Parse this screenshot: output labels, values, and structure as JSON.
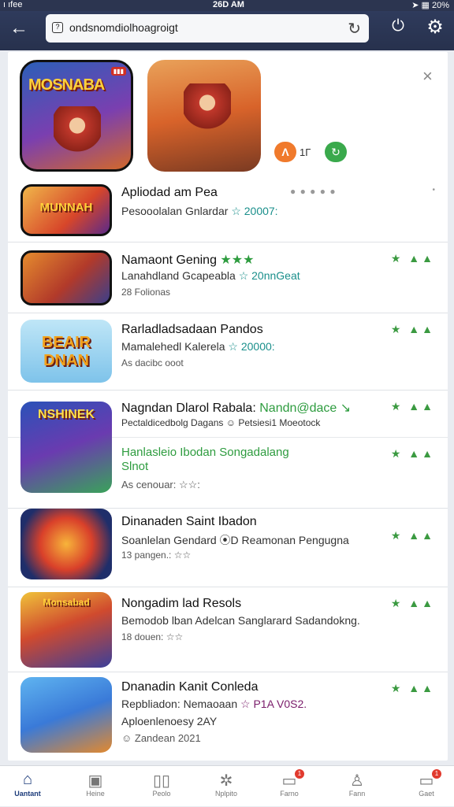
{
  "status": {
    "left": "ı ıfee",
    "time": "26D AM",
    "right": "➤ ▦ 20%"
  },
  "browser": {
    "url": "ondsnomdiolhoagroigt",
    "back_icon": "arrow-left-icon",
    "reload_icon": "reload-icon",
    "power_icon": "power-icon",
    "settings_icon": "gear-icon"
  },
  "featured": {
    "items": [
      {
        "title": "MOSNABA",
        "tag": "▮▮▮"
      },
      {
        "title": ""
      }
    ],
    "mini_badge_1": "Λ",
    "mini_text": "1Г",
    "mini_badge_2": "↻",
    "close": "×"
  },
  "apps": [
    {
      "name": "Apliodad am Pea",
      "sub": "Pesooolalan Gnlardar",
      "sub_hl": "☆ 20007:",
      "meta": "",
      "icon_label": "MUNNAH",
      "dots": "● ● ● ● ●",
      "end": "•"
    },
    {
      "name": "Namaont Gening",
      "name_extra": "★★★",
      "sub": "Lanahdland Gcapeabla",
      "sub_hl": "☆ 20nnGeat",
      "meta": "28 Folionas",
      "icon_label": "",
      "badge": "★ ▲▲"
    },
    {
      "name": "Rarladladsadaan Pandos",
      "sub": "Mamalehedl Kalerela",
      "sub_hl": "☆ 20000:",
      "meta": "As dacibc ooot",
      "icon_label": "BEAIR DNAN",
      "badge": "★ ▲▲"
    },
    {
      "name": "Nagndan Dlarol Rabala:",
      "name_extra": "Nandn@dace ↘",
      "sub": "Pectaldicedbolg Dagans",
      "sub_hl": "☺ Petsiesi1 Moeotock",
      "meta": "",
      "icon_label": "NSHINEK",
      "badge": "★ ▲▲"
    },
    {
      "name": "Hanlasleio Ibodan Songadalang",
      "name2": "Slnot",
      "sub": "",
      "sub_hl": "",
      "meta": "As cenouar: ☆☆:",
      "icon_label": "",
      "badge": "★ ▲▲"
    },
    {
      "name": "Dinanaden Saint Ibadon",
      "sub": "Soanlelan Gendard",
      "sub_hl": "⦿D Reamonan Pengugna",
      "meta": "13 pangen.: ☆☆",
      "icon_label": "",
      "badge": "★ ▲▲"
    },
    {
      "name": "Nongadim lad Resols",
      "sub": "Bemodob lban Adelcan Sanglarard Sadandokng.",
      "sub_hl": "",
      "meta": "18 douen: ☆☆",
      "icon_label": "Monsabad",
      "badge": "★ ▲▲"
    },
    {
      "name": "Dnanadin Kanit Conleda",
      "sub": "Repbliadon: Nemaoaan",
      "sub_hl": "☆ P1A V0S2.",
      "sub2": "Aploenlenoesy 2AY",
      "meta": "☺ Zandean 2021",
      "icon_label": "",
      "badge": "★ ▲▲"
    }
  ],
  "nav": [
    {
      "label": "Uantant",
      "icon": "home-icon",
      "glyph": "⌂",
      "active": true
    },
    {
      "label": "Heine",
      "icon": "image-icon",
      "glyph": "▣"
    },
    {
      "label": "Peolo",
      "icon": "book-icon",
      "glyph": "▯▯"
    },
    {
      "label": "Nplpito",
      "icon": "globe-icon",
      "glyph": "✲"
    },
    {
      "label": "Farno",
      "icon": "inbox-icon",
      "glyph": "▭",
      "badge": "1"
    },
    {
      "label": "Fann",
      "icon": "person-icon",
      "glyph": "♙"
    },
    {
      "label": "Gaet",
      "icon": "chat-icon",
      "glyph": "▭",
      "badge": "1"
    }
  ]
}
